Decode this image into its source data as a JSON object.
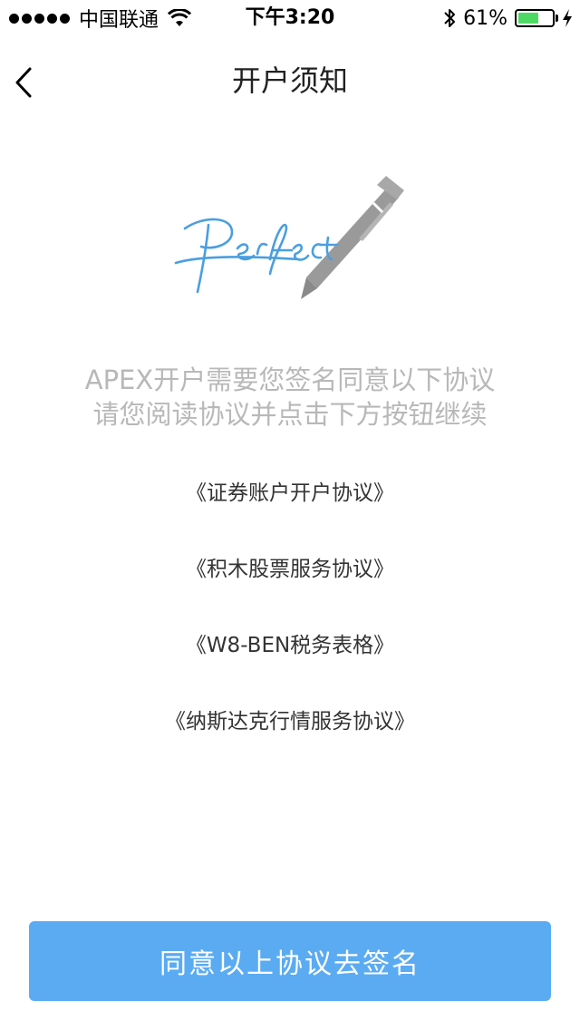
{
  "status_bar": {
    "carrier": "中国联通",
    "time": "下午3:20",
    "battery_percent": "61%",
    "battery_level": 0.61,
    "battery_color": "#4cd964"
  },
  "nav": {
    "title": "开户须知",
    "back_icon": "chevron-left-icon"
  },
  "intro": {
    "line1": "APEX开户需要您签名同意以下协议",
    "line2": "请您阅读协议并点击下方按钮继续"
  },
  "agreements": [
    {
      "label": "《证券账户开户协议》"
    },
    {
      "label": "《积木股票服务协议》"
    },
    {
      "label": "《W8-BEN税务表格》"
    },
    {
      "label": "《纳斯达克行情服务协议》"
    }
  ],
  "action": {
    "agree_label": "同意以上协议去签名",
    "color": "#5aabf2"
  },
  "logo": {
    "icon": "perfect-signature-pen-icon",
    "signature_color": "#4a9fdf",
    "pen_color": "#9a9a9a"
  }
}
